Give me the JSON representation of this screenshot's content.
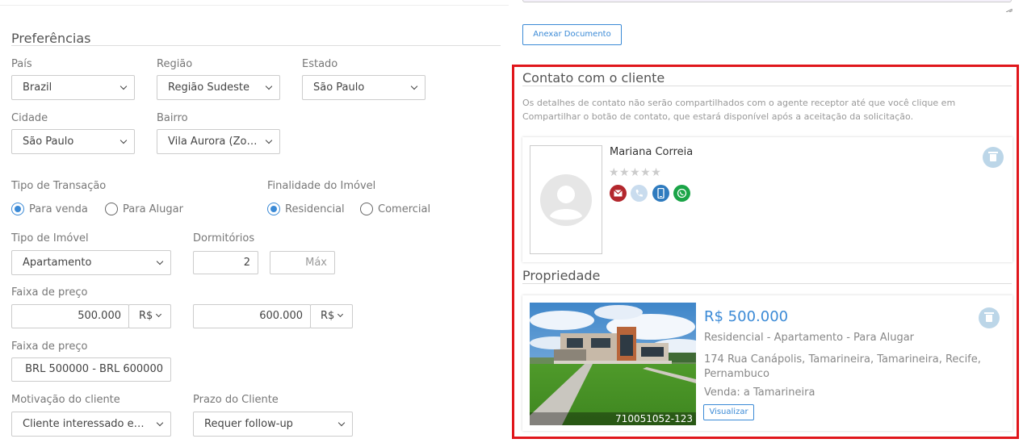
{
  "preferences": {
    "title": "Preferências",
    "country": {
      "label": "País",
      "value": "Brazil"
    },
    "region": {
      "label": "Região",
      "value": "Região Sudeste"
    },
    "state": {
      "label": "Estado",
      "value": "São Paulo"
    },
    "city": {
      "label": "Cidade",
      "value": "São Paulo"
    },
    "neighborhood": {
      "label": "Bairro",
      "value": "Vila Aurora (Zona Norte)"
    },
    "transaction": {
      "label": "Tipo de Transação",
      "options": [
        "Para venda",
        "Para Alugar"
      ],
      "selected": "Para venda"
    },
    "purpose": {
      "label": "Finalidade do Imóvel",
      "options": [
        "Residencial",
        "Comercial"
      ],
      "selected": "Residencial"
    },
    "property_type": {
      "label": "Tipo de Imóvel",
      "value": "Apartamento"
    },
    "bedrooms": {
      "label": "Dormitórios",
      "min": "2",
      "max_placeholder": "Máx"
    },
    "price_range": {
      "label": "Faixa de preço",
      "min": "500.000",
      "max": "600.000",
      "currency": "R$"
    },
    "price_range_summary": {
      "label": "Faixa de preço",
      "value": "BRL 500000 - BRL 600000"
    },
    "motivation": {
      "label": "Motivação do cliente",
      "value": "Cliente interessado em visitar"
    },
    "deadline": {
      "label": "Prazo do Cliente",
      "value": "Requer follow-up"
    }
  },
  "attach_button": "Anexar Documento",
  "contact": {
    "title": "Contato com o cliente",
    "description": "Os detalhes de contato não serão compartilhados com o agente receptor até que você clique em Compartilhar o botão de contato, que estará disponível após a aceitação da solicitação.",
    "name": "Mariana Correia",
    "rating_stars": "★★★★★",
    "rating": 0,
    "channels": [
      "email-icon",
      "phone-icon",
      "mobile-icon",
      "whatsapp-icon"
    ],
    "channel_colors": [
      "#b3272d",
      "#c9dcee",
      "#2f7bbf",
      "#1aa447"
    ]
  },
  "property": {
    "title": "Propriedade",
    "price": "R$ 500.000",
    "type_line": "Residencial - Apartamento - Para Alugar",
    "address": "174 Rua Canápolis, Tamarineira, Tamarineira, Recife, Pernambuco",
    "sale": "Venda: a Tamarineira",
    "ref": "710051052-123",
    "view_button": "Visualizar"
  },
  "highlight_color": "#e0161b",
  "accent_color": "#3b8ad6"
}
